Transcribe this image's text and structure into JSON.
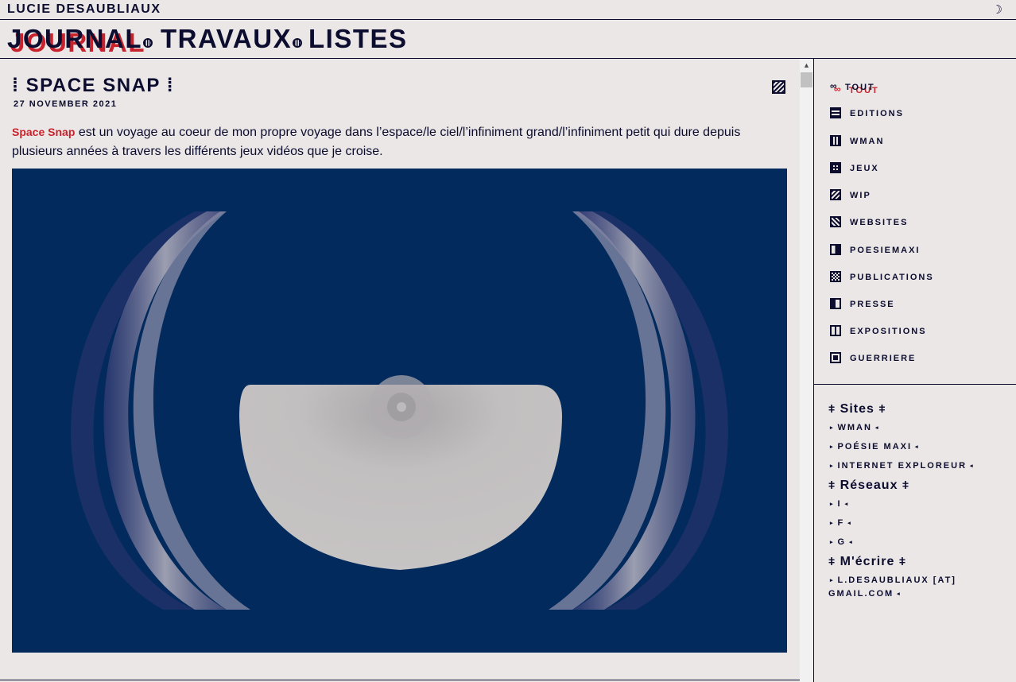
{
  "site": {
    "name": "LUCIE DESAUBLIAUX",
    "theme_toggle": "☽"
  },
  "nav": {
    "items": [
      {
        "label": "JOURNAL",
        "active": true
      },
      {
        "label": "TRAVAUX",
        "active": false
      },
      {
        "label": "LISTES",
        "active": false
      }
    ]
  },
  "post": {
    "title": "⁞ SPACE SNAP ⁞",
    "date": "27 NOVEMBER 2021",
    "lead_link": "Space Snap",
    "body": " est un voyage au coeur de mon propre voyage dans l’espace/le ciel/l’infiniment grand/l’infiniment petit qui dure depuis plusieurs années à travers les différents jeux vidéos que je croise.",
    "category_icon": "websites-icon"
  },
  "categories": [
    {
      "label": "TOUT",
      "icon": "tout-icon",
      "active": true
    },
    {
      "label": "EDITIONS",
      "icon": "editions-icon"
    },
    {
      "label": "WMAN",
      "icon": "wman-icon"
    },
    {
      "label": "JEUX",
      "icon": "jeux-icon"
    },
    {
      "label": "WIP",
      "icon": "wip-icon"
    },
    {
      "label": "WEBSITES",
      "icon": "websites-icon"
    },
    {
      "label": "POESIEMAXI",
      "icon": "poesiemaxi-icon"
    },
    {
      "label": "PUBLICATIONS",
      "icon": "publications-icon"
    },
    {
      "label": "PRESSE",
      "icon": "presse-icon"
    },
    {
      "label": "EXPOSITIONS",
      "icon": "expositions-icon"
    },
    {
      "label": "GUERRIERE",
      "icon": "guerriere-icon"
    }
  ],
  "links": {
    "sites_heading": "Sites",
    "sites": [
      "WMAN",
      "POÉSIE MAXI",
      "INTERNET EXPLOREUR"
    ],
    "reseaux_heading": "Réseaux",
    "reseaux": [
      "I",
      "F",
      "G"
    ],
    "contact_heading": "M'écrire",
    "email": "L.DESAUBLIAUX [AT] GMAIL.COM"
  },
  "colors": {
    "background": "#ebe7e7",
    "ink": "#0b0c2e",
    "accent": "#c8232c",
    "image_bg": "#022a5c"
  }
}
